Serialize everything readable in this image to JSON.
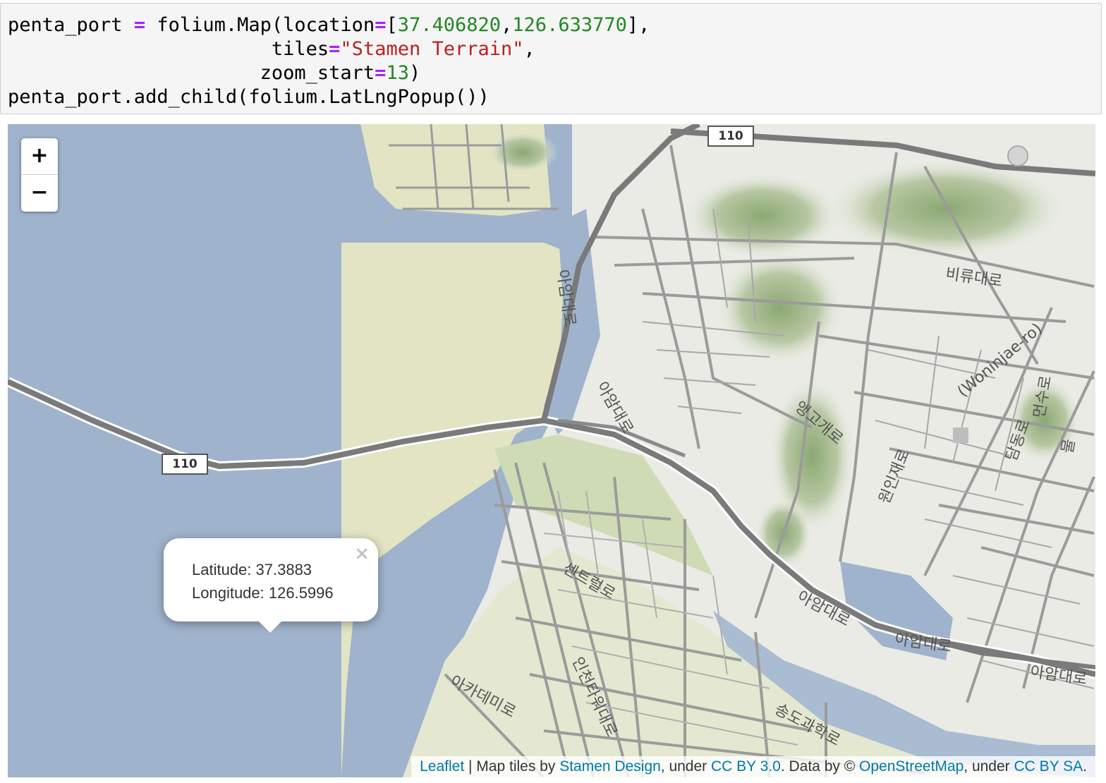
{
  "code": {
    "line1": {
      "a": "penta_port ",
      "op": "=",
      "b": " folium.Map(location",
      "op2": "=",
      "c": "[",
      "n1": "37.406820",
      "d": ",",
      "n2": "126.633770",
      "e": "],"
    },
    "line2": {
      "indent": "                       tiles",
      "op": "=",
      "s": "\"Stamen Terrain\"",
      "e": ","
    },
    "line3": {
      "indent": "                      zoom_start",
      "op": "=",
      "n": "13",
      "e": ")"
    },
    "line4": {
      "text": "penta_port.add_child(folium.LatLngPopup())"
    }
  },
  "map": {
    "tiles": "Stamen Terrain",
    "zoom_in_label": "+",
    "zoom_out_label": "−",
    "shields": [
      "110",
      "110"
    ],
    "road_labels": [
      "아암대로",
      "아암대로",
      "비류대로",
      "(Woninjae-ro)",
      "앵고개로",
      "원인재로",
      "센트럴로",
      "아암대로",
      "아암대로",
      "아암대로",
      "아카데미로",
      "인천타워대로",
      "송도과학로",
      "먼수로",
      "담동로",
      "물"
    ],
    "popup": {
      "latitude": "Latitude: 37.3883",
      "longitude": "Longitude: 126.5996",
      "close": "×"
    },
    "attribution": {
      "leaflet": "Leaflet",
      "sep1": " | Map tiles by ",
      "stamen": "Stamen Design",
      "sep2": ", under ",
      "ccby": "CC BY 3.0",
      "sep3": ". Data by © ",
      "osm": "OpenStreetMap",
      "sep4": ", under ",
      "ccbysa": "CC BY SA",
      "end": "."
    }
  }
}
